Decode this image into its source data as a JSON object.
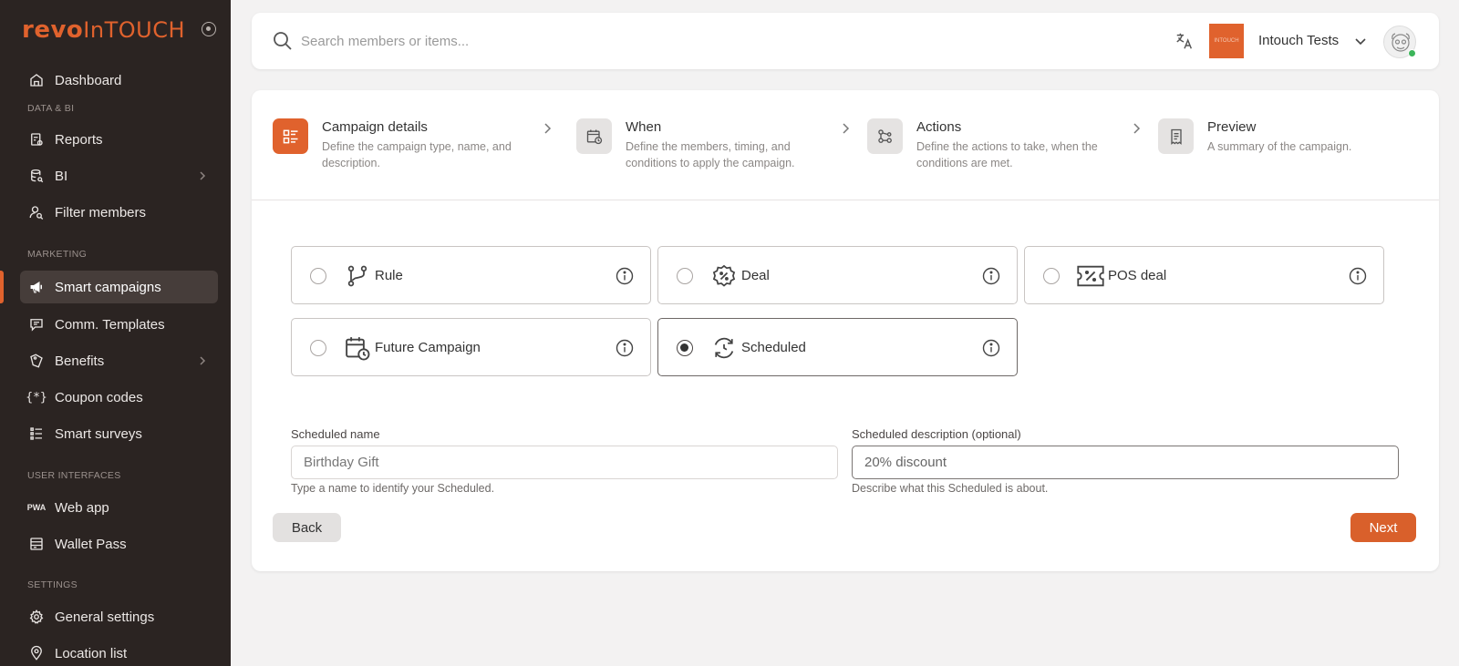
{
  "brand": {
    "logo_bold": "revo",
    "logo_light": "InTOUCH",
    "accent": "#e0622d"
  },
  "sidebar": {
    "items": [
      {
        "label": "Dashboard",
        "icon": "home-icon"
      },
      {
        "label": "Reports",
        "icon": "report-icon"
      },
      {
        "label": "BI",
        "icon": "database-icon"
      },
      {
        "label": "Filter members",
        "icon": "user-search-icon"
      },
      {
        "label": "Smart campaigns",
        "icon": "megaphone-icon"
      },
      {
        "label": "Comm. Templates",
        "icon": "message-icon"
      },
      {
        "label": "Benefits",
        "icon": "tag-icon"
      },
      {
        "label": "Coupon codes",
        "icon": "braces-asterisk-icon"
      },
      {
        "label": "Smart surveys",
        "icon": "list-icon"
      },
      {
        "label": "Web app",
        "icon": "pwa-icon"
      },
      {
        "label": "Wallet Pass",
        "icon": "wallet-icon"
      },
      {
        "label": "General settings",
        "icon": "gear-icon"
      },
      {
        "label": "Location list",
        "icon": "pin-icon"
      }
    ],
    "sections": [
      "DATA & BI",
      "MARKETING",
      "USER INTERFACES",
      "SETTINGS"
    ],
    "pwa_glyph": "PWA"
  },
  "header": {
    "search_placeholder": "Search members or items...",
    "org_logo_text": "INTOUCH",
    "org_name": "Intouch Tests"
  },
  "steps": [
    {
      "title": "Campaign details",
      "desc": "Define the campaign type, name, and description."
    },
    {
      "title": "When",
      "desc": "Define the members, timing, and conditions to apply the campaign."
    },
    {
      "title": "Actions",
      "desc": "Define the actions to take, when the conditions are met."
    },
    {
      "title": "Preview",
      "desc": "A summary of the campaign."
    }
  ],
  "campaign_types": [
    {
      "label": "Rule",
      "selected": false
    },
    {
      "label": "Deal",
      "selected": false
    },
    {
      "label": "POS deal",
      "selected": false
    },
    {
      "label": "Future Campaign",
      "selected": false
    },
    {
      "label": "Scheduled",
      "selected": true
    }
  ],
  "form": {
    "name_label": "Scheduled name",
    "name_value": "Birthday Gift",
    "name_help": "Type a name to identify your Scheduled.",
    "desc_label": "Scheduled description (optional)",
    "desc_value": "20% discount",
    "desc_help": "Describe what this Scheduled is about."
  },
  "buttons": {
    "back": "Back",
    "next": "Next"
  }
}
